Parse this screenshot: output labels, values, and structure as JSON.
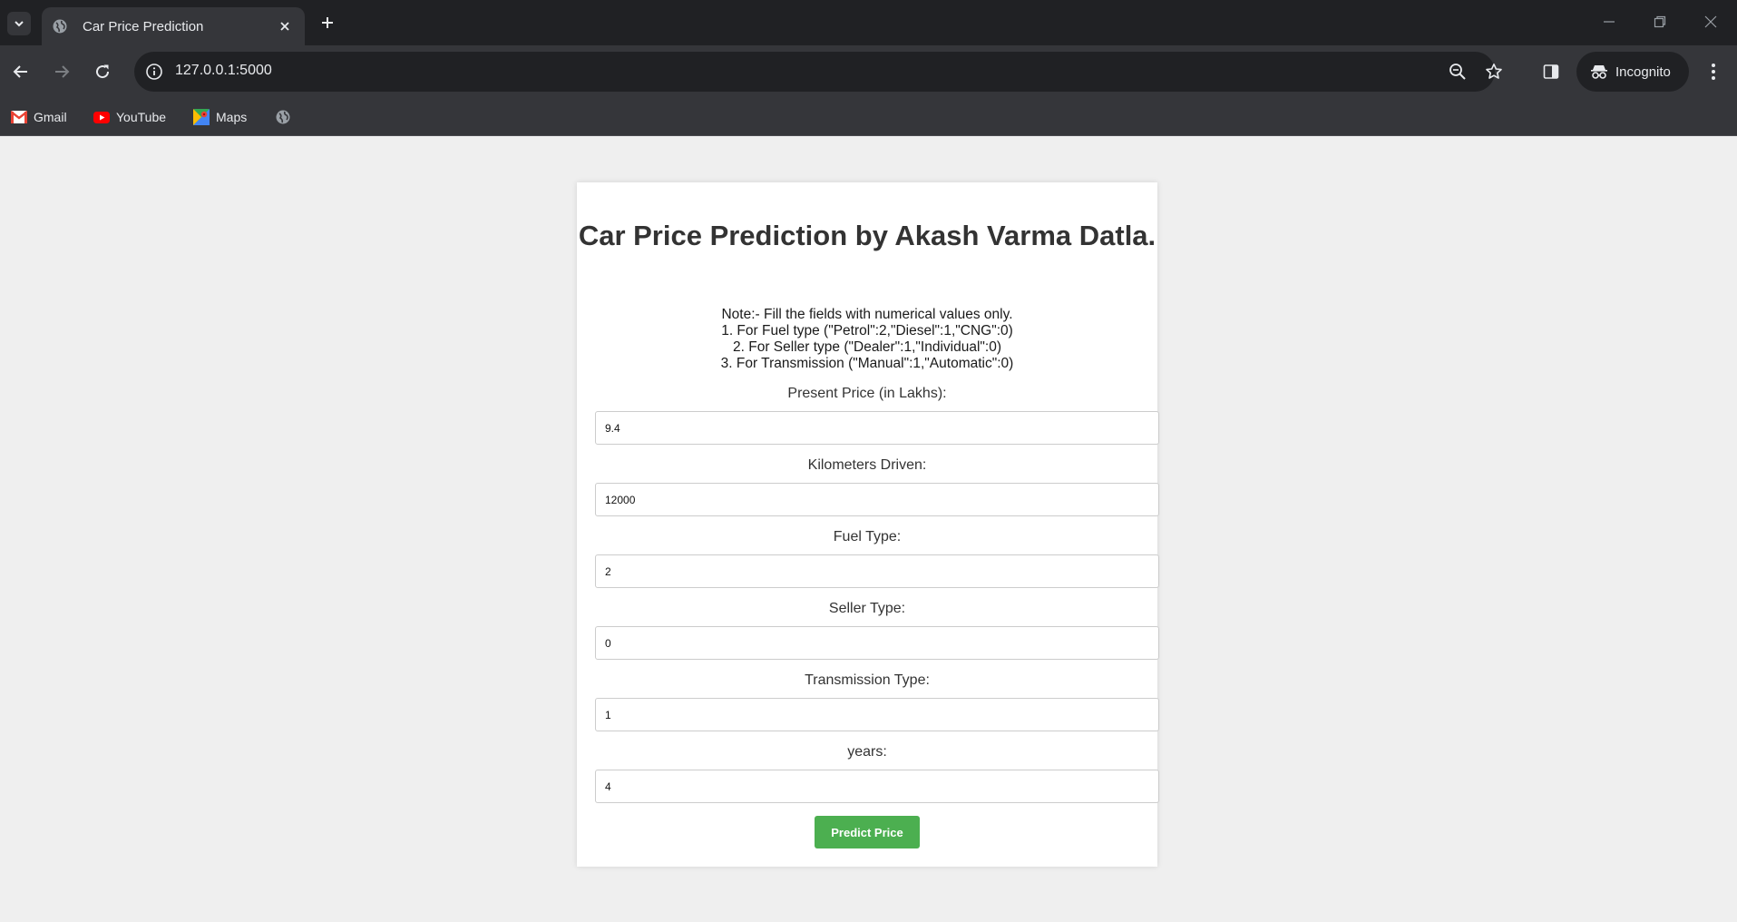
{
  "browser": {
    "tab_title": "Car Price Prediction",
    "url": "127.0.0.1:5000",
    "profile_label": "Incognito",
    "bookmarks": [
      {
        "label": "Gmail",
        "icon": "gmail-icon"
      },
      {
        "label": "YouTube",
        "icon": "youtube-icon"
      },
      {
        "label": "Maps",
        "icon": "maps-icon"
      }
    ]
  },
  "page": {
    "title": "Car Price Prediction by Akash Varma Datla.",
    "notes": [
      "Note:- Fill the fields with numerical values only.",
      "1. For Fuel type (\"Petrol\":2,\"Diesel\":1,\"CNG\":0)",
      "2. For Seller type (\"Dealer\":1,\"Individual\":0)",
      "3. For Transmission (\"Manual\":1,\"Automatic\":0)"
    ],
    "fields": [
      {
        "label": "Present Price (in Lakhs):",
        "value": "9.4"
      },
      {
        "label": "Kilometers Driven:",
        "value": "12000"
      },
      {
        "label": "Fuel Type:",
        "value": "2"
      },
      {
        "label": "Seller Type:",
        "value": "0"
      },
      {
        "label": "Transmission Type:",
        "value": "1"
      },
      {
        "label": "years:",
        "value": "4"
      }
    ],
    "submit_label": "Predict Price"
  },
  "colors": {
    "accent_button": "#4caf50",
    "chrome_dark": "#202124",
    "chrome_toolbar": "#35363a",
    "page_bg": "#efefef"
  }
}
